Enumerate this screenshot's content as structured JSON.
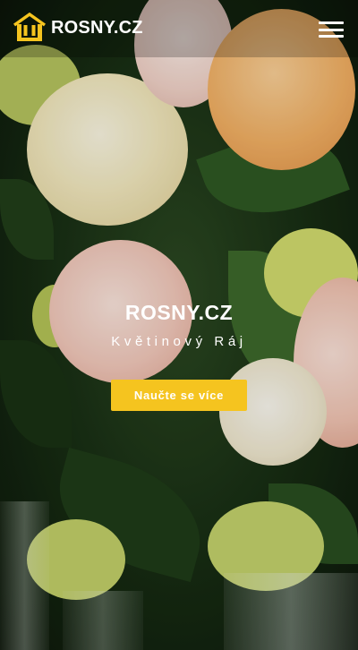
{
  "header": {
    "logo_text": "ROSNY.CZ",
    "logo_icon": "house-icon",
    "menu_icon": "hamburger-menu-icon"
  },
  "hero": {
    "title": "ROSNY.CZ",
    "subtitle": "Květinový Ráj",
    "cta_label": "Naučte se více"
  },
  "colors": {
    "accent": "#f5c41f",
    "text": "#ffffff"
  }
}
